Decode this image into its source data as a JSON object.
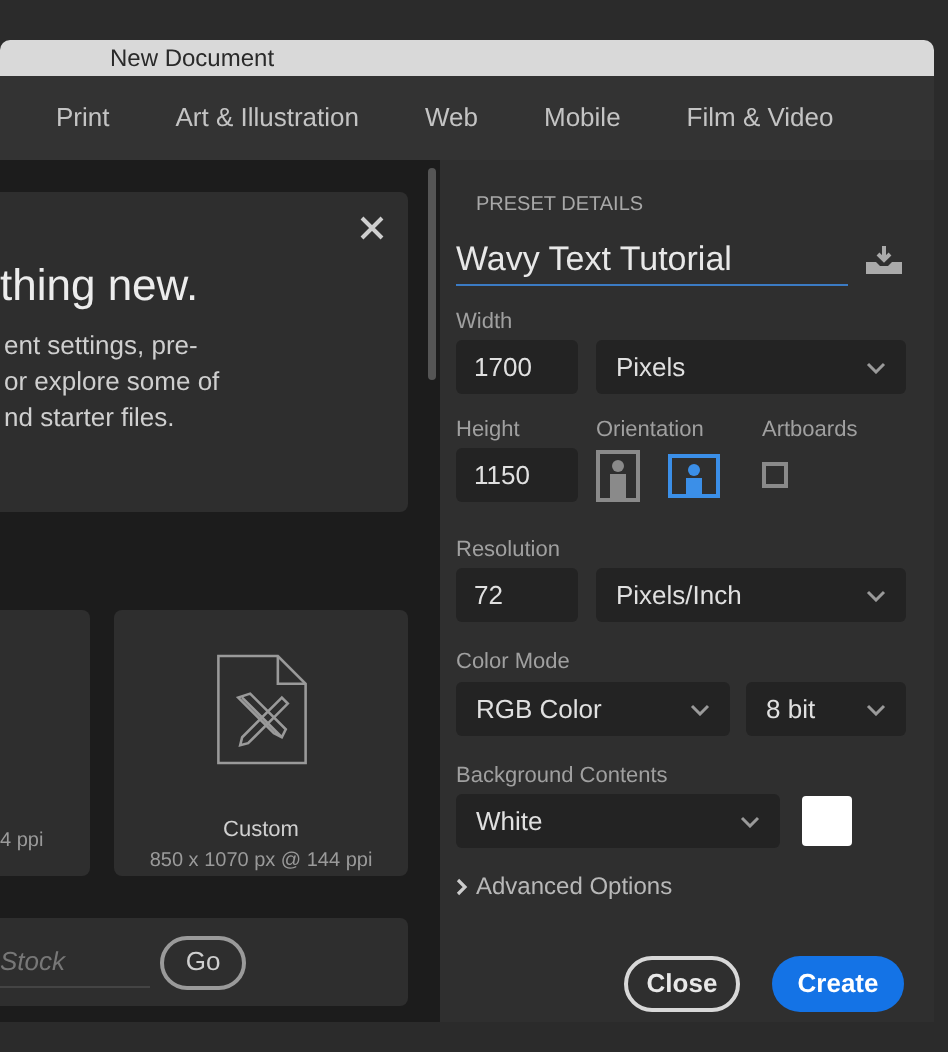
{
  "window": {
    "title": "New Document"
  },
  "tabs": [
    {
      "label": "Print",
      "selected": false
    },
    {
      "label": "Art & Illustration",
      "selected": false
    },
    {
      "label": "Web",
      "selected": false
    },
    {
      "label": "Mobile",
      "selected": false
    },
    {
      "label": "Film & Video",
      "selected": false
    }
  ],
  "intro_card": {
    "heading": "thing new.",
    "text": "ent settings, pre-\nor explore some of\nnd starter files."
  },
  "presets": [
    {
      "kind": "partial",
      "size": "4 ppi"
    },
    {
      "kind": "custom",
      "name": "Custom",
      "size": "850 x 1070 px @ 144 ppi"
    }
  ],
  "stock_search": {
    "placeholder": "Stock",
    "button": "Go"
  },
  "preset_details": {
    "heading": "PRESET DETAILS",
    "name": "Wavy Text Tutorial",
    "width": {
      "label": "Width",
      "value": "1700",
      "unit": "Pixels"
    },
    "height": {
      "label": "Height",
      "value": "1150"
    },
    "orientation": {
      "label": "Orientation",
      "options": [
        {
          "kind": "portrait",
          "selected": false
        },
        {
          "kind": "landscape",
          "selected": true
        }
      ]
    },
    "artboards": {
      "label": "Artboards",
      "checked": false
    },
    "resolution": {
      "label": "Resolution",
      "value": "72",
      "unit": "Pixels/Inch"
    },
    "color_mode": {
      "label": "Color Mode",
      "mode": "RGB Color",
      "depth": "8 bit"
    },
    "background": {
      "label": "Background Contents",
      "value": "White",
      "color": "#ffffff"
    },
    "advanced": {
      "label": "Advanced Options",
      "expanded": false
    }
  },
  "buttons": [
    {
      "kind": "secondary",
      "label": "Close"
    },
    {
      "kind": "primary",
      "label": "Create"
    }
  ]
}
